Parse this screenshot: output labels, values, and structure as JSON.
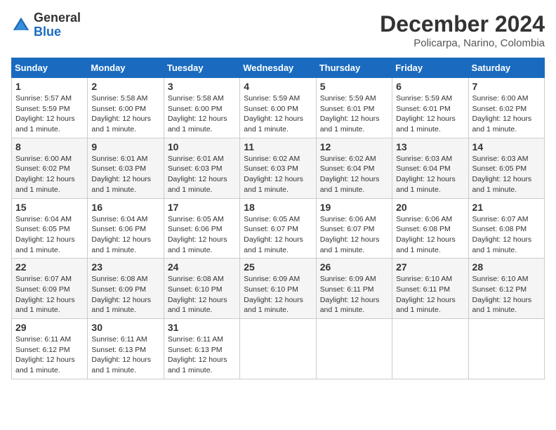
{
  "header": {
    "logo": {
      "general": "General",
      "blue": "Blue"
    },
    "title": "December 2024",
    "location": "Policarpa, Narino, Colombia"
  },
  "weekdays": [
    "Sunday",
    "Monday",
    "Tuesday",
    "Wednesday",
    "Thursday",
    "Friday",
    "Saturday"
  ],
  "weeks": [
    [
      {
        "day": 1,
        "sunrise": "5:57 AM",
        "sunset": "5:59 PM",
        "daylight": "12 hours and 1 minute."
      },
      {
        "day": 2,
        "sunrise": "5:58 AM",
        "sunset": "6:00 PM",
        "daylight": "12 hours and 1 minute."
      },
      {
        "day": 3,
        "sunrise": "5:58 AM",
        "sunset": "6:00 PM",
        "daylight": "12 hours and 1 minute."
      },
      {
        "day": 4,
        "sunrise": "5:59 AM",
        "sunset": "6:00 PM",
        "daylight": "12 hours and 1 minute."
      },
      {
        "day": 5,
        "sunrise": "5:59 AM",
        "sunset": "6:01 PM",
        "daylight": "12 hours and 1 minute."
      },
      {
        "day": 6,
        "sunrise": "5:59 AM",
        "sunset": "6:01 PM",
        "daylight": "12 hours and 1 minute."
      },
      {
        "day": 7,
        "sunrise": "6:00 AM",
        "sunset": "6:02 PM",
        "daylight": "12 hours and 1 minute."
      }
    ],
    [
      {
        "day": 8,
        "sunrise": "6:00 AM",
        "sunset": "6:02 PM",
        "daylight": "12 hours and 1 minute."
      },
      {
        "day": 9,
        "sunrise": "6:01 AM",
        "sunset": "6:03 PM",
        "daylight": "12 hours and 1 minute."
      },
      {
        "day": 10,
        "sunrise": "6:01 AM",
        "sunset": "6:03 PM",
        "daylight": "12 hours and 1 minute."
      },
      {
        "day": 11,
        "sunrise": "6:02 AM",
        "sunset": "6:03 PM",
        "daylight": "12 hours and 1 minute."
      },
      {
        "day": 12,
        "sunrise": "6:02 AM",
        "sunset": "6:04 PM",
        "daylight": "12 hours and 1 minute."
      },
      {
        "day": 13,
        "sunrise": "6:03 AM",
        "sunset": "6:04 PM",
        "daylight": "12 hours and 1 minute."
      },
      {
        "day": 14,
        "sunrise": "6:03 AM",
        "sunset": "6:05 PM",
        "daylight": "12 hours and 1 minute."
      }
    ],
    [
      {
        "day": 15,
        "sunrise": "6:04 AM",
        "sunset": "6:05 PM",
        "daylight": "12 hours and 1 minute."
      },
      {
        "day": 16,
        "sunrise": "6:04 AM",
        "sunset": "6:06 PM",
        "daylight": "12 hours and 1 minute."
      },
      {
        "day": 17,
        "sunrise": "6:05 AM",
        "sunset": "6:06 PM",
        "daylight": "12 hours and 1 minute."
      },
      {
        "day": 18,
        "sunrise": "6:05 AM",
        "sunset": "6:07 PM",
        "daylight": "12 hours and 1 minute."
      },
      {
        "day": 19,
        "sunrise": "6:06 AM",
        "sunset": "6:07 PM",
        "daylight": "12 hours and 1 minute."
      },
      {
        "day": 20,
        "sunrise": "6:06 AM",
        "sunset": "6:08 PM",
        "daylight": "12 hours and 1 minute."
      },
      {
        "day": 21,
        "sunrise": "6:07 AM",
        "sunset": "6:08 PM",
        "daylight": "12 hours and 1 minute."
      }
    ],
    [
      {
        "day": 22,
        "sunrise": "6:07 AM",
        "sunset": "6:09 PM",
        "daylight": "12 hours and 1 minute."
      },
      {
        "day": 23,
        "sunrise": "6:08 AM",
        "sunset": "6:09 PM",
        "daylight": "12 hours and 1 minute."
      },
      {
        "day": 24,
        "sunrise": "6:08 AM",
        "sunset": "6:10 PM",
        "daylight": "12 hours and 1 minute."
      },
      {
        "day": 25,
        "sunrise": "6:09 AM",
        "sunset": "6:10 PM",
        "daylight": "12 hours and 1 minute."
      },
      {
        "day": 26,
        "sunrise": "6:09 AM",
        "sunset": "6:11 PM",
        "daylight": "12 hours and 1 minute."
      },
      {
        "day": 27,
        "sunrise": "6:10 AM",
        "sunset": "6:11 PM",
        "daylight": "12 hours and 1 minute."
      },
      {
        "day": 28,
        "sunrise": "6:10 AM",
        "sunset": "6:12 PM",
        "daylight": "12 hours and 1 minute."
      }
    ],
    [
      {
        "day": 29,
        "sunrise": "6:11 AM",
        "sunset": "6:12 PM",
        "daylight": "12 hours and 1 minute."
      },
      {
        "day": 30,
        "sunrise": "6:11 AM",
        "sunset": "6:13 PM",
        "daylight": "12 hours and 1 minute."
      },
      {
        "day": 31,
        "sunrise": "6:11 AM",
        "sunset": "6:13 PM",
        "daylight": "12 hours and 1 minute."
      },
      null,
      null,
      null,
      null
    ]
  ]
}
